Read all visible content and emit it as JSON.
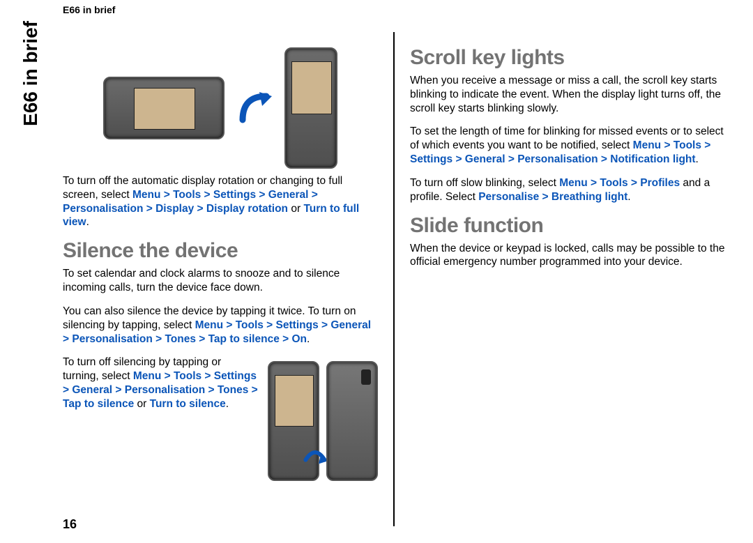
{
  "header": {
    "running_head": "E66 in brief",
    "side_tab": "E66 in brief",
    "page_number": "16"
  },
  "left": {
    "rotation": {
      "intro": "To turn off the automatic display rotation or changing to full screen, select ",
      "path": "Menu > Tools > Settings > General > Personalisation > Display > Display rotation",
      "or_word": " or ",
      "alt_path": "Turn to full view",
      "end": "."
    },
    "silence": {
      "heading": "Silence the device",
      "p1": "To set calendar and clock alarms to snooze and to silence incoming calls, turn the device face down.",
      "p2_a": "You can also silence the device by tapping it twice. To turn on silencing by tapping, select ",
      "p2_path": "Menu > Tools > Settings > General > Personalisation > Tones > Tap to silence > On",
      "p2_end": ".",
      "p3_a": "To turn off silencing by tapping or turning, select ",
      "p3_path": "Menu > Tools > Settings > General > Personalisation > Tones > Tap to silence",
      "p3_or": " or ",
      "p3_alt": "Turn to silence",
      "p3_end": "."
    }
  },
  "right": {
    "scroll": {
      "heading": "Scroll key lights",
      "p1": "When you receive a message or miss a call, the scroll key starts blinking to indicate the event. When the display light turns off, the scroll key starts blinking slowly.",
      "p2_a": "To set the length of time for blinking for missed events or to select of which events you want to be notified, select ",
      "p2_path": "Menu > Tools > Settings > General > Personalisation > Notification light",
      "p2_end": ".",
      "p3_a": "To turn off slow blinking, select ",
      "p3_path1": "Menu > Tools > Profiles",
      "p3_mid": " and a profile. Select ",
      "p3_path2": "Personalise > Breathing light",
      "p3_end": "."
    },
    "slide": {
      "heading": "Slide function",
      "p1": "When the device or keypad is locked, calls may be possible to the official emergency number programmed into your device."
    }
  }
}
